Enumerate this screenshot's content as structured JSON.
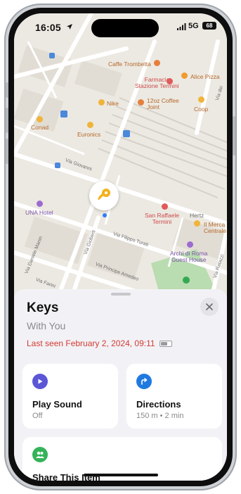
{
  "status_bar": {
    "time": "16:05",
    "network": "5G",
    "battery": "68"
  },
  "map": {
    "pois": [
      {
        "id": "caffe-trombetta",
        "label": "Caffe Trombetta"
      },
      {
        "id": "farmacia",
        "label": "Farmacia\nStazione Termini"
      },
      {
        "id": "alice-pizza",
        "label": "Alice Pizza"
      },
      {
        "id": "nike",
        "label": "Nike"
      },
      {
        "id": "12oz",
        "label": "12oz Coffee\nJoint"
      },
      {
        "id": "coop",
        "label": "Coop"
      },
      {
        "id": "conad",
        "label": "Conad"
      },
      {
        "id": "euronics",
        "label": "Euronics"
      },
      {
        "id": "una-hotel",
        "label": "UNA Hotel"
      },
      {
        "id": "san-raffaele",
        "label": "San Raffaele\nTermini"
      },
      {
        "id": "hertz",
        "label": "Hertz"
      },
      {
        "id": "il-mercato",
        "label": "Il Merca\nCentrale"
      },
      {
        "id": "archi",
        "label": "Archi di Roma\nGuest House"
      }
    ],
    "streets": [
      {
        "id": "giolitti",
        "label": "Via Giovanni"
      },
      {
        "id": "turati",
        "label": "Via Filippo Turati"
      },
      {
        "id": "gioberti",
        "label": "Via Gioberti"
      },
      {
        "id": "amedeo",
        "label": "Via Principe Amedeo"
      },
      {
        "id": "manin",
        "label": "Via Daniele Manin"
      },
      {
        "id": "farini",
        "label": "Via Farini"
      },
      {
        "id": "ratazzi",
        "label": "Via Ratazzi"
      },
      {
        "id": "marsala",
        "label": "Via dei"
      }
    ],
    "pin_icon": "key-icon"
  },
  "sheet": {
    "title": "Keys",
    "subtitle": "With You",
    "last_seen": "Last seen February 2, 2024, 09:11",
    "actions": [
      {
        "id": "play-sound",
        "label": "Play Sound",
        "value": "Off",
        "icon": "play-icon",
        "color": "#5b56d6"
      },
      {
        "id": "directions",
        "label": "Directions",
        "value": "150 m • 2 min",
        "icon": "directions-icon",
        "color": "#1f7ae0"
      },
      {
        "id": "share",
        "label": "Share This Item",
        "value": "",
        "icon": "people-icon",
        "color": "#34b35a"
      }
    ]
  }
}
